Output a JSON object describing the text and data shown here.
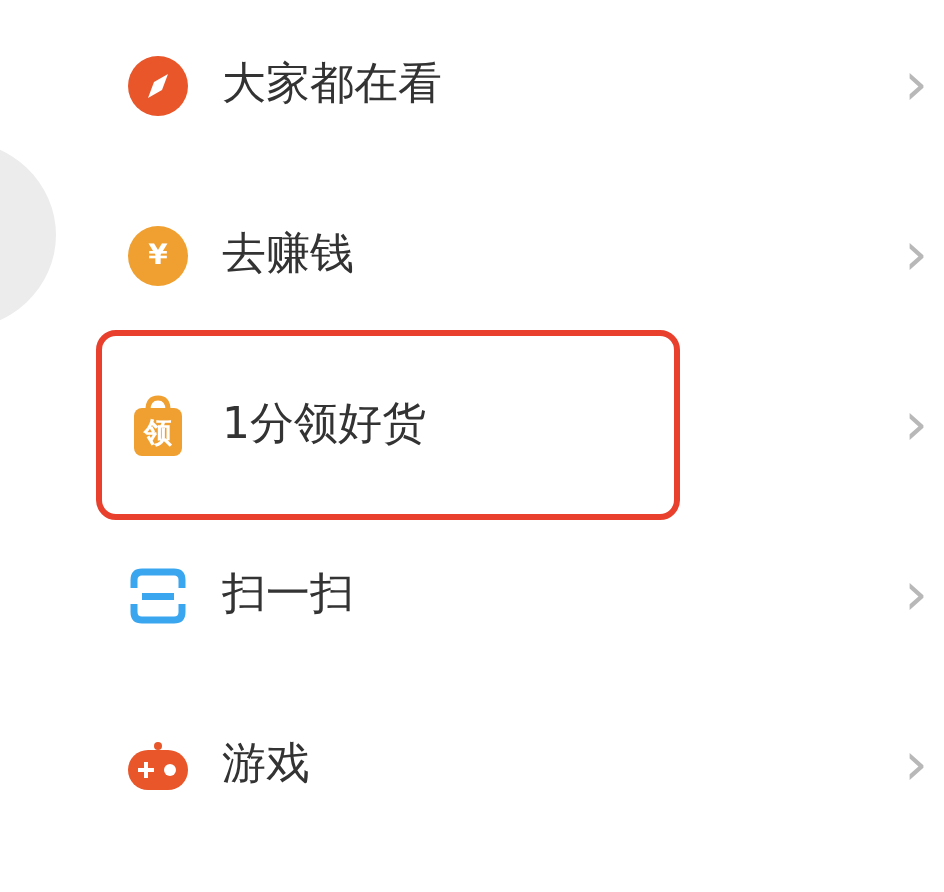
{
  "menu": [
    {
      "kind": "compass",
      "label": "大家都在看",
      "highlighted": false,
      "chevron": "›"
    },
    {
      "kind": "yen",
      "icon_text": "¥",
      "label": "去赚钱",
      "highlighted": false,
      "chevron": "›"
    },
    {
      "kind": "bag",
      "icon_text": "领",
      "label": "1分领好货",
      "highlighted": true,
      "chevron": "›"
    },
    {
      "kind": "scan",
      "label": "扫一扫",
      "highlighted": false,
      "chevron": "›"
    },
    {
      "kind": "game",
      "label": "游戏",
      "highlighted": false,
      "chevron": "›"
    }
  ]
}
